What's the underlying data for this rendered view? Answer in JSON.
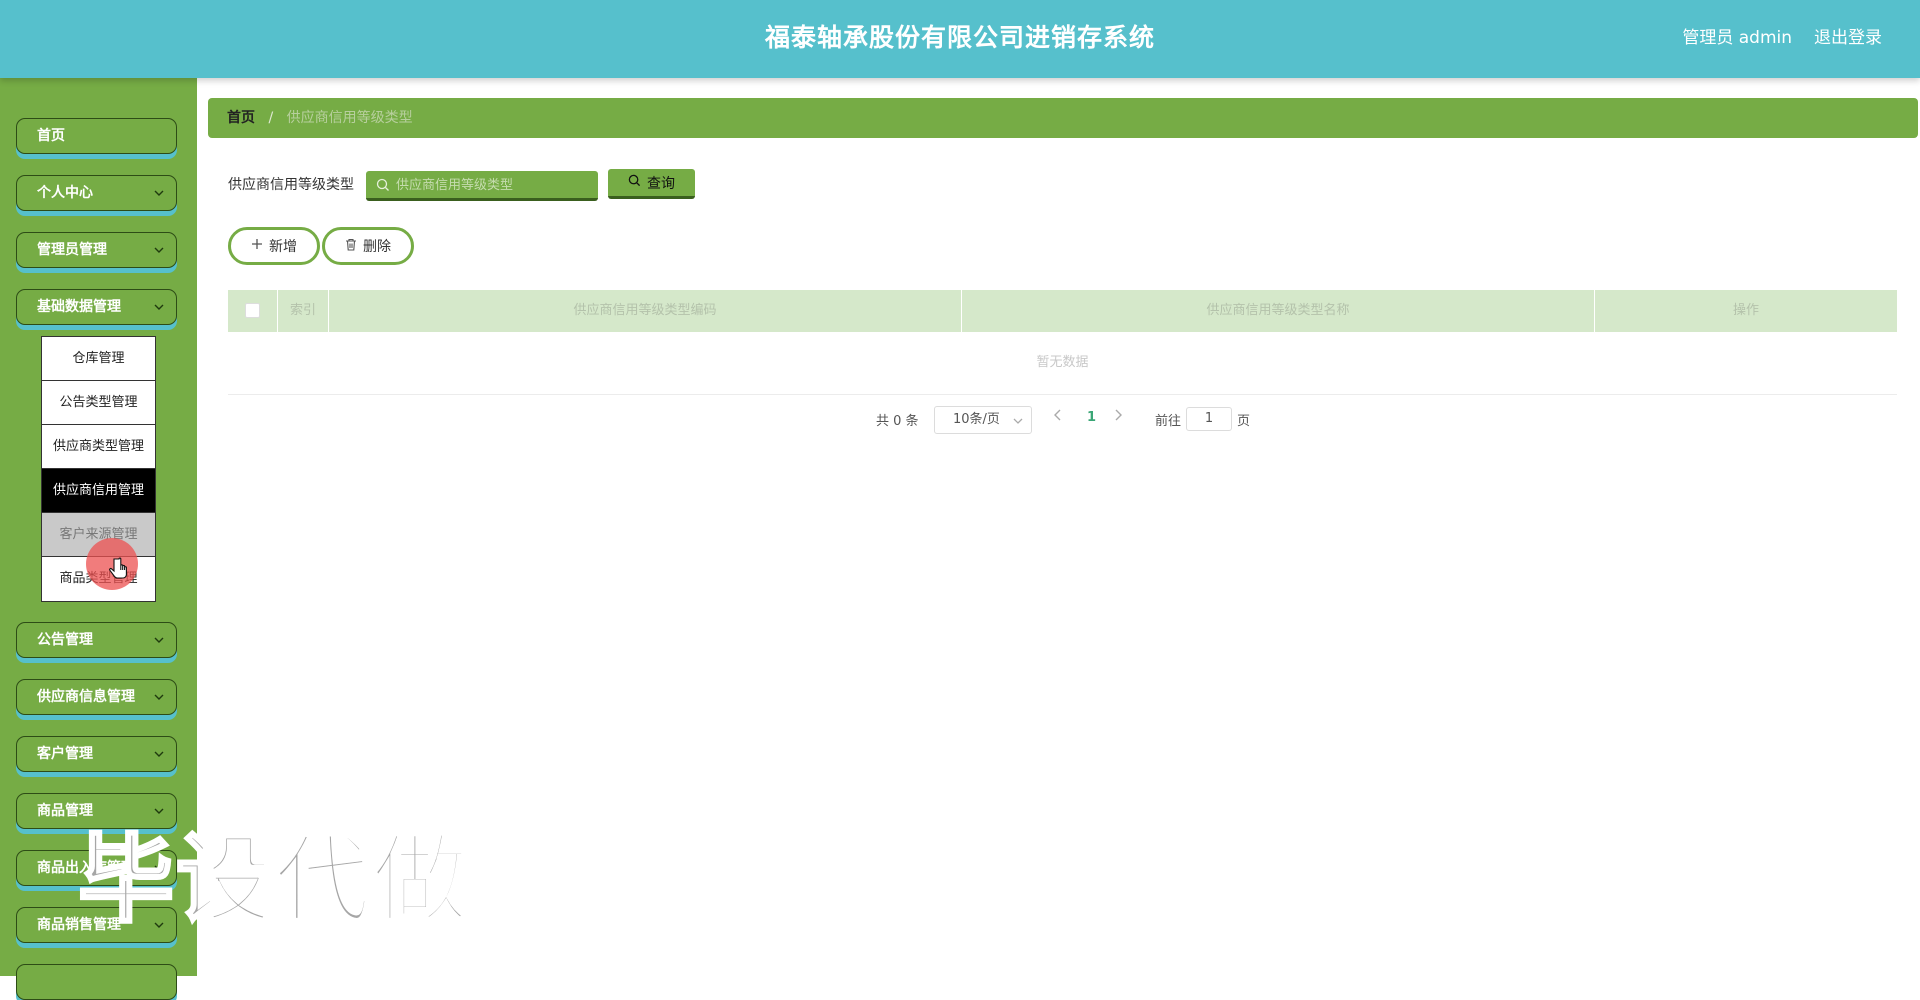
{
  "header": {
    "title": "福泰轴承股份有限公司进销存系统",
    "user": "管理员 admin",
    "logout": "退出登录"
  },
  "sidebar": {
    "items": [
      {
        "label": "首页"
      },
      {
        "label": "个人中心"
      },
      {
        "label": "管理员管理"
      },
      {
        "label": "基础数据管理"
      },
      {
        "label": "公告管理"
      },
      {
        "label": "供应商信息管理"
      },
      {
        "label": "客户管理"
      },
      {
        "label": "商品管理"
      },
      {
        "label": "商品出入库管理"
      },
      {
        "label": "商品销售管理"
      }
    ],
    "submenu": [
      {
        "label": "仓库管理"
      },
      {
        "label": "公告类型管理"
      },
      {
        "label": "供应商类型管理"
      },
      {
        "label": "供应商信用管理"
      },
      {
        "label": "客户来源管理"
      },
      {
        "label": "商品类型管理"
      }
    ]
  },
  "breadcrumb": {
    "home": "首页",
    "sep": "/",
    "current": "供应商信用等级类型"
  },
  "search": {
    "label": "供应商信用等级类型",
    "placeholder": "供应商信用等级类型",
    "query_label": "查询"
  },
  "actions": {
    "add_label": "新增",
    "delete_label": "删除"
  },
  "table": {
    "columns": [
      "索引",
      "供应商信用等级类型编码",
      "供应商信用等级类型名称",
      "操作"
    ],
    "empty_text": "暂无数据"
  },
  "pagination": {
    "total": "共 0 条",
    "page_size": "10条/页",
    "current_page": "1",
    "goto_label": "前往",
    "goto_value": "1",
    "page_unit": "页"
  },
  "watermark": "毕设代做",
  "colors": {
    "header": "#56c0cc",
    "sidebar": "#76ac45",
    "table_head": "#d5e8ca"
  }
}
